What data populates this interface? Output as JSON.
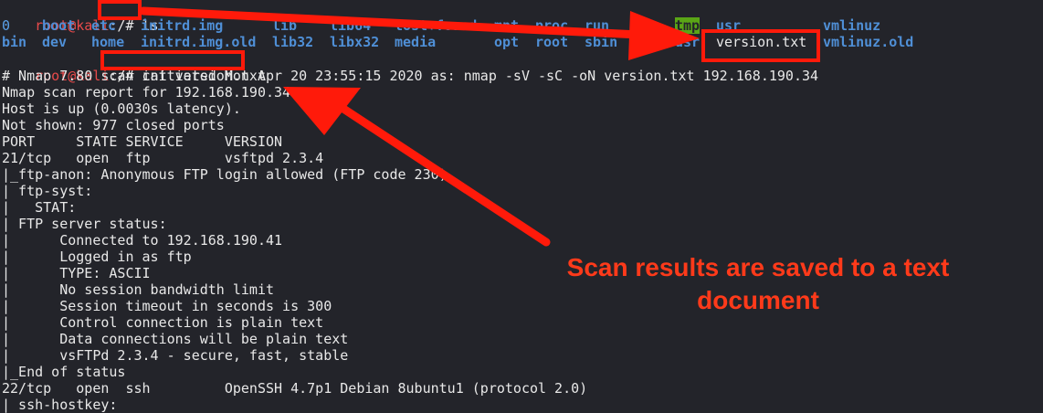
{
  "prompt": {
    "user_host": "root@kali",
    "path": ":/# "
  },
  "commands": {
    "ls": "ls",
    "cat": "cat version.txt"
  },
  "ls_output": {
    "row1": [
      "0",
      "boot",
      "etc",
      "initrd.img",
      "lib",
      "lib64",
      "lost+found",
      "mnt",
      "proc",
      "run",
      "srv",
      "tmp",
      "usr",
      "vmlinuz"
    ],
    "row2": [
      "bin",
      "dev",
      "home",
      "initrd.img.old",
      "lib32",
      "libx32",
      "media",
      "opt",
      "root",
      "sbin",
      "sys",
      "usr",
      "version.txt",
      "vmlinuz.old"
    ]
  },
  "file_output": [
    "# Nmap 7.80 scan initiated Mon Apr 20 23:55:15 2020 as: nmap -sV -sC -oN version.txt 192.168.190.34",
    "Nmap scan report for 192.168.190.34",
    "Host is up (0.0030s latency).",
    "Not shown: 977 closed ports",
    "PORT     STATE SERVICE     VERSION",
    "21/tcp   open  ftp         vsftpd 2.3.4",
    "|_ftp-anon: Anonymous FTP login allowed (FTP code 230)",
    "| ftp-syst:",
    "|   STAT:",
    "| FTP server status:",
    "|      Connected to 192.168.190.41",
    "|      Logged in as ftp",
    "|      TYPE: ASCII",
    "|      No session bandwidth limit",
    "|      Session timeout in seconds is 300",
    "|      Control connection is plain text",
    "|      Data connections will be plain text",
    "|      vsFTPd 2.3.4 - secure, fast, stable",
    "|_End of status",
    "22/tcp   open  ssh         OpenSSH 4.7p1 Debian 8ubuntu1 (protocol 2.0)",
    "| ssh-hostkey:"
  ],
  "annotation": {
    "callout_text": "Scan results are saved to a text document",
    "accent_color": "#ff1a0a"
  }
}
